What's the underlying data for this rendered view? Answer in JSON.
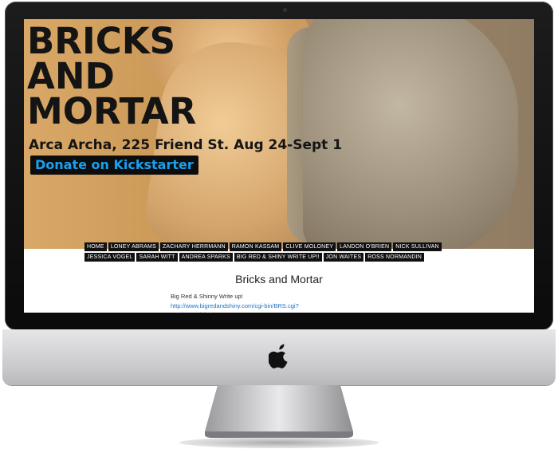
{
  "hero": {
    "title_lines": [
      "BRICKS",
      "AND",
      "MORTAR"
    ],
    "subtitle": "Arca Archa, 225 Friend St. Aug 24-Sept 1",
    "donate_label": "Donate on Kickstarter"
  },
  "nav": {
    "items": [
      "HOME",
      "LONEY ABRAMS",
      "ZACHARY HERRMANN",
      "RAMON KASSAM",
      "CLIVE MOLONEY",
      "LANDON O'BRIEN",
      "NICK SULLIVAN",
      "JESSICA VOGEL",
      "SARAH WITT",
      "ANDREA SPARKS",
      "BIG RED & SHINY WRITE UP!!",
      "JON WAITES",
      "ROSS NORMANDIN"
    ]
  },
  "content": {
    "page_title": "Bricks and Mortar",
    "post_label": "Big Red & Shinny Write up!",
    "post_link": "http://www.bigredandshiny.com/cgi-bin/BRS.cgi?section=article&issue=BLOG"
  },
  "colors": {
    "link": "#1a73c8",
    "donate_text": "#1aa0f0",
    "nav_bg": "#111111"
  },
  "icons": [
    "apple-logo-icon"
  ]
}
